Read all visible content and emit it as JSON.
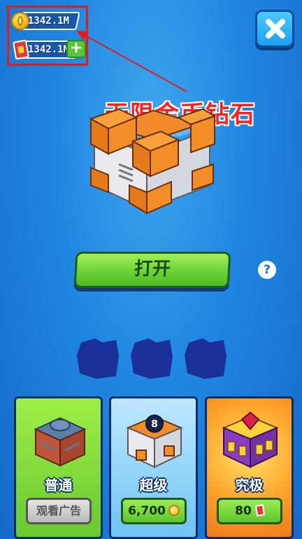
{
  "currency": {
    "coins": "1342.1M",
    "gems": "1342.1M",
    "coin_icon": "gold-coin-icon",
    "gem_icon": "red-card-icon",
    "add_icon": "plus-icon"
  },
  "annotation": {
    "text": "无限金币钻石",
    "color": "#ff1f1f"
  },
  "chest": {
    "open_label": "打开",
    "help_label": "?"
  },
  "cards": [
    {
      "title": "普通",
      "button_label": "观看广告"
    },
    {
      "title": "超级",
      "price": "6,700",
      "currency_icon": "gold-coin-icon"
    },
    {
      "title": "究极",
      "price": "80",
      "currency_icon": "red-card-icon"
    }
  ],
  "colors": {
    "background": "#1f86e0",
    "accent_green": "#6ad336",
    "highlight_red": "#e21a1a"
  }
}
